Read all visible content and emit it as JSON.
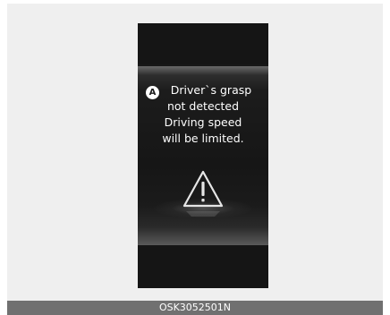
{
  "display": {
    "badge_letter": "A",
    "message_lines": [
      "Driver`s grasp",
      "not detected",
      "Driving speed",
      "will be limited."
    ],
    "icon": "warning-triangle-icon"
  },
  "caption": "OSK3052501N",
  "colors": {
    "background": "#efefef",
    "display": "#181818",
    "caption_bar": "#707070"
  }
}
